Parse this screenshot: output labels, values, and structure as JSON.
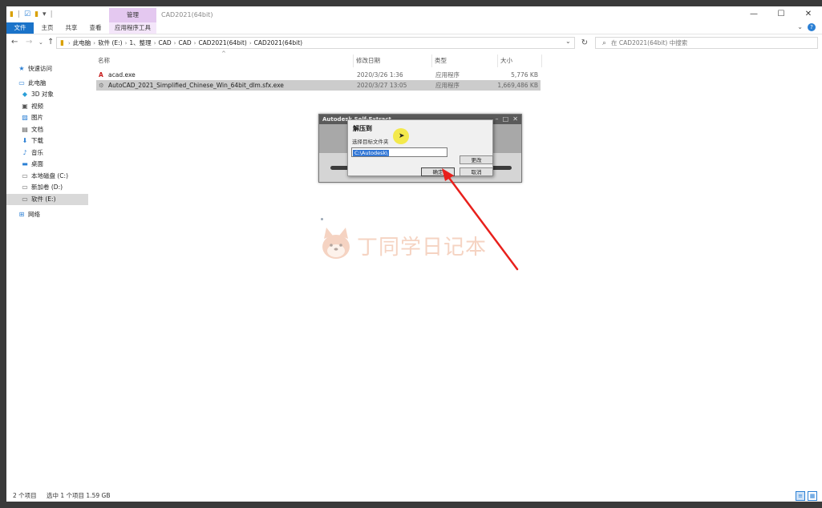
{
  "window": {
    "title": "CAD2021(64bit)"
  },
  "ribbon": {
    "context_tab": "管理",
    "tabs": [
      {
        "label": "文件",
        "key": "file"
      },
      {
        "label": "主页",
        "key": "home"
      },
      {
        "label": "共享",
        "key": "share"
      },
      {
        "label": "查看",
        "key": "view"
      },
      {
        "label": "应用程序工具",
        "key": "app"
      }
    ]
  },
  "address": {
    "crumbs": [
      "此电脑",
      "软件 (E:)",
      "1、整理",
      "CAD",
      "CAD",
      "CAD2021(64bit)",
      "CAD2021(64bit)"
    ],
    "search_placeholder": "在 CAD2021(64bit) 中搜索"
  },
  "sidebar": {
    "items": [
      {
        "label": "快速访问",
        "icon": "star-icon",
        "color": "#2a7fd4"
      },
      {
        "label": "此电脑",
        "icon": "computer-icon",
        "color": "#2a7fd4"
      },
      {
        "label": "3D 对象",
        "icon": "cube-icon",
        "color": "#2a9fd8"
      },
      {
        "label": "视频",
        "icon": "video-icon",
        "color": "#555555"
      },
      {
        "label": "图片",
        "icon": "picture-icon",
        "color": "#2a7fd4"
      },
      {
        "label": "文档",
        "icon": "document-icon",
        "color": "#555555"
      },
      {
        "label": "下载",
        "icon": "download-icon",
        "color": "#2a7fd4"
      },
      {
        "label": "音乐",
        "icon": "music-icon",
        "color": "#2a7fd4"
      },
      {
        "label": "桌面",
        "icon": "desktop-icon",
        "color": "#2a7fd4"
      },
      {
        "label": "本地磁盘 (C:)",
        "icon": "drive-icon",
        "color": "#666666"
      },
      {
        "label": "新加卷 (D:)",
        "icon": "drive-icon",
        "color": "#666666"
      },
      {
        "label": "软件 (E:)",
        "icon": "drive-icon",
        "color": "#666666",
        "selected": true
      },
      {
        "label": "网络",
        "icon": "network-icon",
        "color": "#2a7fd4"
      }
    ]
  },
  "filelist": {
    "columns": {
      "name": "名称",
      "date": "修改日期",
      "type": "类型",
      "size": "大小"
    },
    "rows": [
      {
        "name": "acad.exe",
        "date": "2020/3/26 1:36",
        "type": "应用程序",
        "size": "5,776 KB",
        "icon": "autocad-icon",
        "selected": false
      },
      {
        "name": "AutoCAD_2021_Simplified_Chinese_Win_64bit_dlm.sfx.exe",
        "date": "2020/3/27 13:05",
        "type": "应用程序",
        "size": "1,669,486 KB",
        "icon": "installer-icon",
        "selected": true
      }
    ]
  },
  "status": {
    "count": "2 个项目",
    "selection": "选中 1 个项目  1.59 GB"
  },
  "sfx_window": {
    "title": "Autodesk Self-Extract"
  },
  "dialog": {
    "title": "解压到",
    "subtitle": "选择目标文件夹",
    "path_value": "C:\\Autodesk\\",
    "change_label": "更改",
    "ok_label": "确定",
    "cancel_label": "取消"
  },
  "watermark": {
    "text": "丁同学日记本"
  },
  "colors": {
    "accent": "#1a73c9",
    "annotation_arrow": "#e8201c",
    "cursor_highlight": "#f3e83a"
  }
}
